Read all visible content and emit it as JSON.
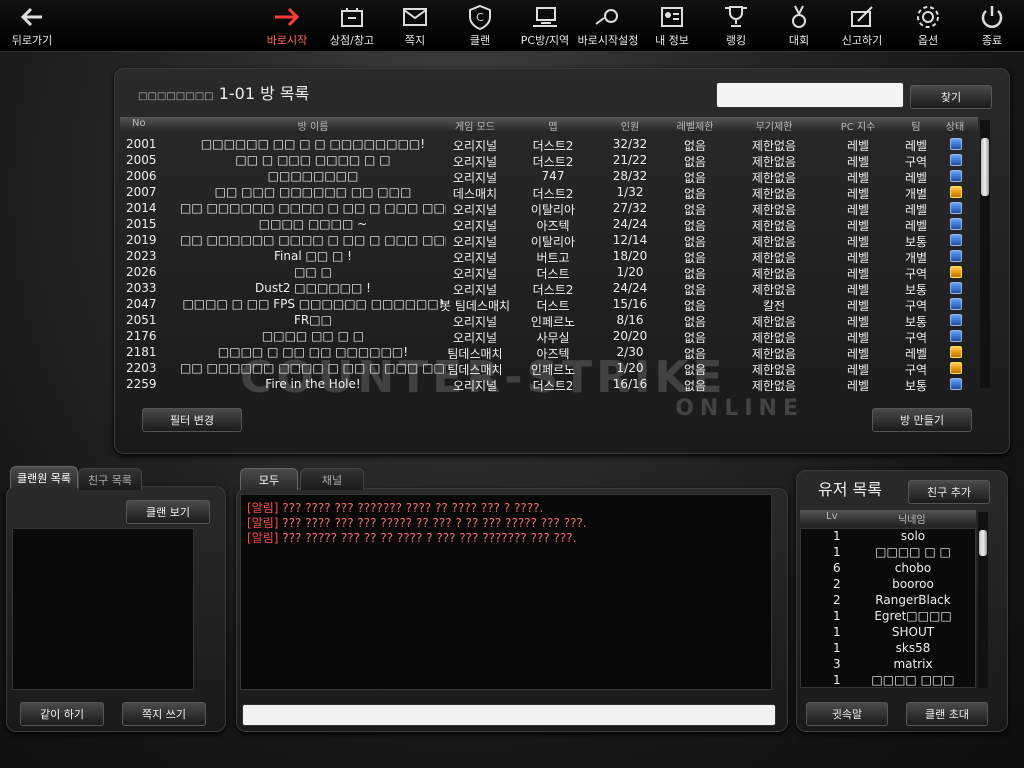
{
  "topbar": {
    "items": [
      {
        "label": "뒤로가기",
        "icon": "back-arrow-icon"
      },
      {
        "label": "바로시작",
        "icon": "double-arrow-icon",
        "active": true
      },
      {
        "label": "상점/창고",
        "icon": "shop-icon"
      },
      {
        "label": "쪽지",
        "icon": "mail-icon"
      },
      {
        "label": "클랜",
        "icon": "clan-shield-icon"
      },
      {
        "label": "PC방/지역",
        "icon": "pc-room-icon"
      },
      {
        "label": "바로시작설정",
        "icon": "settings-gear-icon"
      },
      {
        "label": "내 정보",
        "icon": "id-card-icon"
      },
      {
        "label": "랭킹",
        "icon": "trophy-icon"
      },
      {
        "label": "대회",
        "icon": "medal-icon"
      },
      {
        "label": "신고하기",
        "icon": "report-pen-icon"
      },
      {
        "label": "옵션",
        "icon": "gear-icon"
      },
      {
        "label": "종료",
        "icon": "power-icon"
      }
    ]
  },
  "room_list": {
    "title_prefix": "□□□□□□□□",
    "title": "1-01 방 목록",
    "search_value": "",
    "search_button": "찾기",
    "columns": [
      "No",
      "방 이름",
      "게임 모드",
      "맵",
      "인원",
      "레벨제한",
      "무기제한",
      "PC 지수",
      "팀",
      "상태"
    ],
    "rows": [
      {
        "no": "2001",
        "name": "□□□□□□ □□ □ □ □□□□□□□□!",
        "mode": "오리지널",
        "map": "더스트2",
        "players": "32/32",
        "level": "없음",
        "weapon": "제한없음",
        "pc": "레벨",
        "team": "레벨",
        "status": "play"
      },
      {
        "no": "2005",
        "name": "□□ □ □□□ □□□□ □ □",
        "mode": "오리지널",
        "map": "더스트2",
        "players": "21/22",
        "level": "없음",
        "weapon": "제한없음",
        "pc": "레벨",
        "team": "구역",
        "status": "play"
      },
      {
        "no": "2006",
        "name": "□□□□□□□□",
        "mode": "오리지널",
        "map": "747",
        "players": "28/32",
        "level": "없음",
        "weapon": "제한없음",
        "pc": "레벨",
        "team": "레벨",
        "status": "play"
      },
      {
        "no": "2007",
        "name": "□□ □□□ □□□□□□ □□ □□□",
        "mode": "데스매치",
        "map": "더스트2",
        "players": "1/32",
        "level": "없음",
        "weapon": "제한없음",
        "pc": "레벨",
        "team": "개별",
        "status": "wait"
      },
      {
        "no": "2014",
        "name": "□□ □□□□□□ □□□□ □ □□ □ □□□ □□□□!",
        "mode": "오리지널",
        "map": "이탈리아",
        "players": "27/32",
        "level": "없음",
        "weapon": "제한없음",
        "pc": "레벨",
        "team": "레벨",
        "status": "play"
      },
      {
        "no": "2015",
        "name": "□□□□ □□□□ ~",
        "mode": "오리지널",
        "map": "아즈텍",
        "players": "24/24",
        "level": "없음",
        "weapon": "제한없음",
        "pc": "레벨",
        "team": "레벨",
        "status": "play"
      },
      {
        "no": "2019",
        "name": "□□ □□□□□□ □□□□ □ □□ □ □□□ □□□□!",
        "mode": "오리지널",
        "map": "이탈리아",
        "players": "12/14",
        "level": "없음",
        "weapon": "제한없음",
        "pc": "레벨",
        "team": "보통",
        "status": "play"
      },
      {
        "no": "2023",
        "name": "Final □□ □ !",
        "mode": "오리지널",
        "map": "버트고",
        "players": "18/20",
        "level": "없음",
        "weapon": "제한없음",
        "pc": "레벨",
        "team": "개별",
        "status": "play"
      },
      {
        "no": "2026",
        "name": "□□ □",
        "mode": "오리지널",
        "map": "더스트",
        "players": "1/20",
        "level": "없음",
        "weapon": "제한없음",
        "pc": "레벨",
        "team": "구역",
        "status": "wait"
      },
      {
        "no": "2033",
        "name": "Dust2 □□□□□□ !",
        "mode": "오리지널",
        "map": "더스트2",
        "players": "24/24",
        "level": "없음",
        "weapon": "제한없음",
        "pc": "레벨",
        "team": "보통",
        "status": "play"
      },
      {
        "no": "2047",
        "name": "□□□□ □ □□ FPS □□□□□□ □□□□□□!",
        "mode": "봇 팀데스매치",
        "map": "더스트",
        "players": "15/16",
        "level": "없음",
        "weapon": "칼전",
        "pc": "레벨",
        "team": "구역",
        "status": "play"
      },
      {
        "no": "2051",
        "name": "FR□□",
        "mode": "오리지널",
        "map": "인페르노",
        "players": "8/16",
        "level": "없음",
        "weapon": "제한없음",
        "pc": "레벨",
        "team": "보통",
        "status": "play"
      },
      {
        "no": "2176",
        "name": "□□□□ □□ □ □",
        "mode": "오리지널",
        "map": "사무실",
        "players": "20/20",
        "level": "없음",
        "weapon": "제한없음",
        "pc": "레벨",
        "team": "구역",
        "status": "play"
      },
      {
        "no": "2181",
        "name": "□□□□ □ □□ □□ □□□□□□!",
        "mode": "팀데스매치",
        "map": "아즈텍",
        "players": "2/30",
        "level": "없음",
        "weapon": "제한없음",
        "pc": "레벨",
        "team": "레벨",
        "status": "wait"
      },
      {
        "no": "2203",
        "name": "□□ □□□□□□ □□□□ □ □□ □ □□□ □□□□!",
        "mode": "팀데스매치",
        "map": "인페르노",
        "players": "1/20",
        "level": "없음",
        "weapon": "제한없음",
        "pc": "레벨",
        "team": "구역",
        "status": "wait"
      },
      {
        "no": "2259",
        "name": "Fire in the Hole!",
        "mode": "오리지널",
        "map": "더스트2",
        "players": "16/16",
        "level": "없음",
        "weapon": "제한없음",
        "pc": "레벨",
        "team": "보통",
        "status": "play"
      }
    ],
    "filter_button": "필터 변경",
    "create_button": "방 만들기",
    "logo_main": "COUNTER-STRIKE",
    "logo_sub": "ONLINE"
  },
  "left_panel": {
    "tabs": [
      "클랜원 목록",
      "친구 목록"
    ],
    "clan_view_button": "클랜 보기",
    "play_together_button": "같이 하기",
    "send_note_button": "쪽지 쓰기"
  },
  "chat": {
    "tabs": [
      "모두",
      "채널"
    ],
    "lines": [
      {
        "tag": "[알림]",
        "text": " ??? ???? ??? ??????? ???? ?? ???? ??? ? ????."
      },
      {
        "tag": "[알림]",
        "text": " ??? ???? ??? ??? ????? ?? ??? ? ?? ??? ????? ??? ???."
      },
      {
        "tag": "[알림]",
        "text": " ??? ????? ??? ?? ?? ???? ? ??? ??? ??????? ??? ???."
      }
    ],
    "input_value": ""
  },
  "user_list": {
    "title": "유저 목록",
    "add_friend_button": "친구 추가",
    "columns": [
      "Lv",
      "닉네임"
    ],
    "users": [
      {
        "lv": "1",
        "name": "solo"
      },
      {
        "lv": "1",
        "name": "□□□□ □ □"
      },
      {
        "lv": "6",
        "name": "chobo"
      },
      {
        "lv": "2",
        "name": "booroo"
      },
      {
        "lv": "2",
        "name": "RangerBlack"
      },
      {
        "lv": "1",
        "name": "Egret□□□□"
      },
      {
        "lv": "1",
        "name": "SHOUT"
      },
      {
        "lv": "1",
        "name": "sks58"
      },
      {
        "lv": "3",
        "name": "matrix"
      },
      {
        "lv": "1",
        "name": "□□□□ □□□"
      }
    ],
    "whisper_button": "귓속말",
    "clan_invite_button": "클랜 초대"
  },
  "colors": {
    "accent": "#ff3b3b",
    "chat_text": "#f26a6a",
    "status_play": "#2b6fe0",
    "status_wait": "#f0a020"
  }
}
